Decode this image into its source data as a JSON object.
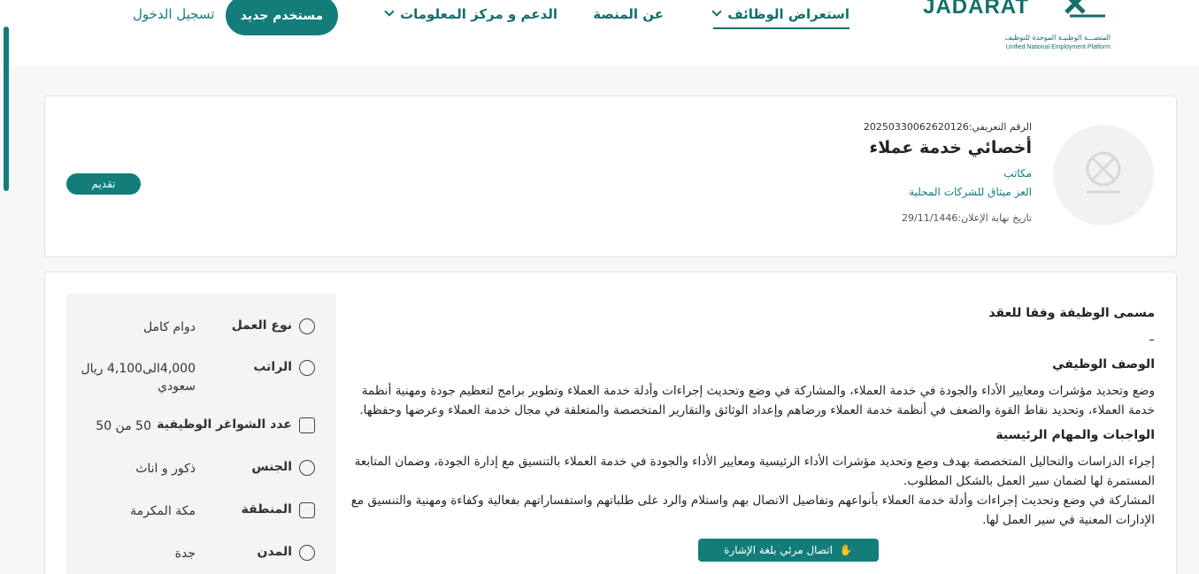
{
  "header": {
    "logo_text": "JADARAT",
    "logo_sub_ar": "المنصـــة الوطنيـة الموحدة للتوظيف",
    "logo_sub_en": "Unified National Employment Platform",
    "nav": {
      "jobs": "استعراض الوظائف",
      "about": "عن المنصة",
      "support": "الدعم و مركز المعلومات"
    },
    "new_user": "مستخدم جديد",
    "login": "تسجيل الدخول"
  },
  "job": {
    "id_text": "الرقم التعريفي:20250330062620126",
    "title": "أخصائي خدمة عملاء",
    "type": "مكاتب",
    "company": "العز ميثاق للشركات المحلية",
    "deadline": "تاريخ نهاية الإعلان:29/11/1446",
    "apply": "تقديم"
  },
  "details": {
    "contract_title_heading": "مسمى الوظيفة وفقا للعقد",
    "contract_title_value": "–",
    "description_heading": "الوصف الوظيفي",
    "description": "وضع وتحديد مؤشرات ومعايير الأداء والجودة في خدمة العملاء، والمشاركة في وضع وتحديث إجراءات وأدلة خدمة العملاء وتطوير برامج لتعظيم جودة ومهنية أنظمة خدمة العملاء، وتحديد نقاط القوة والضعف في أنظمة خدمة العملاء ورضاهم وإعداد الوثائق والتقارير المتخصصة والمتعلقة في مجال خدمة العملاء وعرضها وحفظها.",
    "duties_heading": "الواجبات والمهام الرئيسية",
    "duty_1": "إجراء الدراسات والتحاليل المتخصصة بهدف وضع وتحديد مؤشرات الأداء الرئيسية ومعايير الأداء والجودة في خدمة العملاء بالتنسيق مع إدارة الجودة، وضمان المتابعة المستمرة لها لضمان سير العمل بالشكل المطلوب.",
    "duty_2": "المشاركة في وضع وتحديث إجراءات وأدلة خدمة العملاء بأنواعهم وتفاصيل الاتصال بهم واستلام والرد على طلباتهم واستفساراتهم بفعالية وكفاءة ومهنية والتنسيق مع الإدارات المعنية في سير العمل لها."
  },
  "sidebar": {
    "work_type_label": "نوع العمل",
    "work_type_value": "دوام كامل",
    "salary_label": "الراتب",
    "salary_value": "4,000الى4,100 ريال سعودي",
    "vacancies_label": "عدد الشواغر الوظيفية",
    "vacancies_value": "50 من 50",
    "gender_label": "الجنس",
    "gender_value": "ذكور و اناث",
    "region_label": "المنطقة",
    "region_value": "مكة المكرمة",
    "city_label": "المدن",
    "city_value": "جدة"
  },
  "sign_language": "اتصال مرئي بلغة الإشارة",
  "colors": {
    "primary": "#137d7a"
  }
}
